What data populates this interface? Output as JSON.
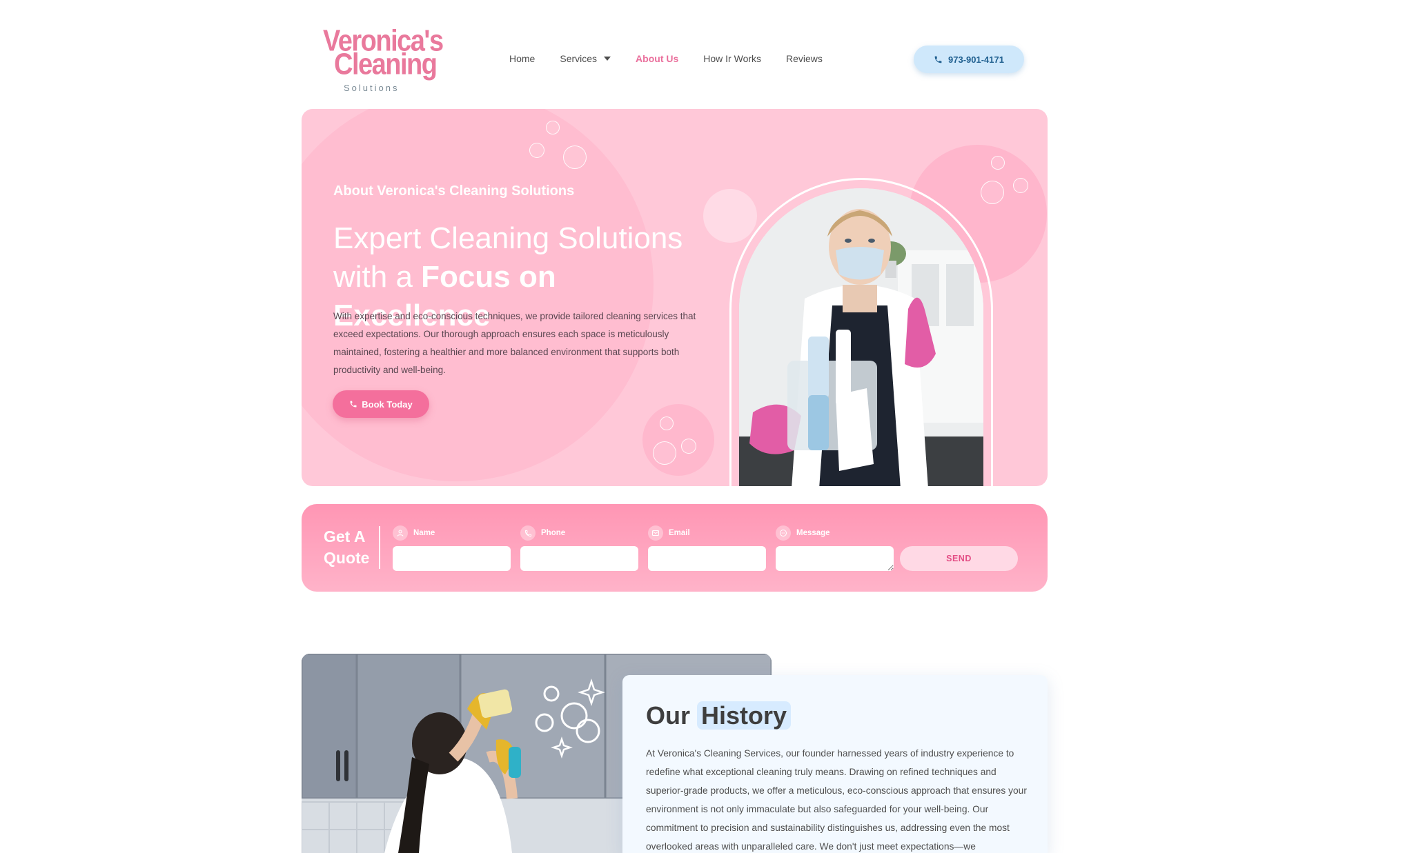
{
  "brand": {
    "logo_line1": "Veronica's",
    "logo_line2": "Cleaning",
    "logo_sub": "Solutions",
    "accent_color": "#ea6f9c",
    "hero_bg": "#ffc8d8"
  },
  "nav": {
    "items": [
      {
        "label": "Home",
        "active": false
      },
      {
        "label": "Services",
        "active": false,
        "has_dropdown": true
      },
      {
        "label": "About Us",
        "active": true
      },
      {
        "label": "How Ir Works",
        "active": false
      },
      {
        "label": "Reviews",
        "active": false
      }
    ],
    "phone": "973-901-4171",
    "phone_icon": "phone-icon"
  },
  "hero": {
    "kicker": "About Veronica's Cleaning Solutions",
    "title_line1": "Expert Cleaning Solutions",
    "title_line2_prefix": "with a ",
    "title_line2_strong": "Focus on Excellence",
    "body": "With expertise and eco-conscious techniques, we provide tailored cleaning services that exceed expectations. Our thorough approach ensures each space is meticulously maintained, fostering a healthier and more balanced environment that supports both productivity and well-being.",
    "cta_label": "Book Today",
    "image": "cleaner-woman-thumbs-up-photo"
  },
  "quote": {
    "title_line1": "Get A",
    "title_line2": "Quote",
    "fields": [
      {
        "label": "Name",
        "icon": "user-icon",
        "value": ""
      },
      {
        "label": "Phone",
        "icon": "phone-icon",
        "value": ""
      },
      {
        "label": "Email",
        "icon": "mail-icon",
        "value": ""
      },
      {
        "label": "Message",
        "icon": "chat-icon",
        "value": ""
      }
    ],
    "send_label": "SEND"
  },
  "history": {
    "title_plain": "Our",
    "title_highlight": "History",
    "body": "At Veronica's Cleaning Services, our founder harnessed years of industry experience to redefine what exceptional cleaning truly means. Drawing on refined techniques and superior-grade products, we offer a meticulous, eco-conscious approach that ensures your environment is not only immaculate but also safeguarded for your well-being. Our commitment to precision and sustainability distinguishes us, addressing even the most overlooked areas with unparalleled care. We don't just meet expectations—we",
    "image": "woman-wiping-cabinet-photo"
  }
}
